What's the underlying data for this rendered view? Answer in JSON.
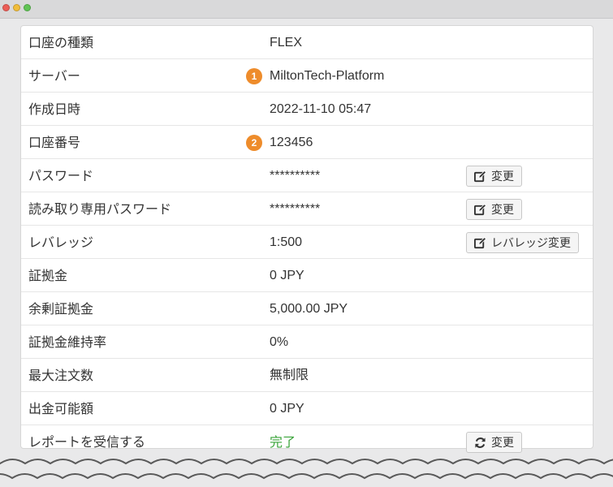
{
  "window": {
    "controls": {
      "close_color": "#ec5e57",
      "minimize_color": "#f1bd3a",
      "zoom_color": "#60c454"
    }
  },
  "badge_color": "#ee8c2b",
  "success_color": "#3aa43a",
  "rows": [
    {
      "label": "口座の種類",
      "value": "FLEX"
    },
    {
      "label": "サーバー",
      "value": "MiltonTech-Platform",
      "badge": "1"
    },
    {
      "label": "作成日時",
      "value": "2022-11-10 05:47"
    },
    {
      "label": "口座番号",
      "value": "123456",
      "badge": "2"
    },
    {
      "label": "パスワード",
      "value": "**********",
      "button": {
        "label": "変更",
        "icon": "edit-icon"
      }
    },
    {
      "label": "読み取り専用パスワード",
      "value": "**********",
      "button": {
        "label": "変更",
        "icon": "edit-icon"
      }
    },
    {
      "label": "レバレッジ",
      "value": "1:500",
      "button": {
        "label": "レバレッジ変更",
        "icon": "edit-icon"
      }
    },
    {
      "label": "証拠金",
      "value": "0 JPY"
    },
    {
      "label": "余剰証拠金",
      "value": "5,000.00 JPY"
    },
    {
      "label": "証拠金維持率",
      "value": "0%"
    },
    {
      "label": "最大注文数",
      "value": "無制限"
    },
    {
      "label": "出金可能額",
      "value": "0 JPY"
    },
    {
      "label": "レポートを受信する",
      "value": "完了",
      "status": "success",
      "button": {
        "label": "変更",
        "icon": "refresh-icon"
      }
    }
  ]
}
